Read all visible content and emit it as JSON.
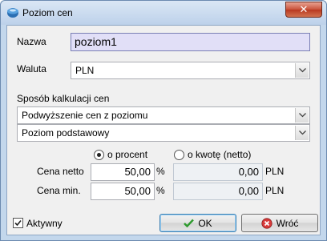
{
  "window": {
    "title": "Poziom cen",
    "close_glyph": "✕"
  },
  "form": {
    "nazwa_label": "Nazwa",
    "nazwa_value": "poziom1",
    "waluta_label": "Waluta",
    "waluta_value": "PLN",
    "sposob_label": "Sposób kalkulacji cen",
    "sposob_value": "Podwyższenie cen z poziomu",
    "poziom_value": "Poziom podstawowy",
    "radio_procent_label": "o procent",
    "radio_kwote_label": "o kwotę (netto)",
    "radio_selected": "procent",
    "cena_netto_label": "Cena netto",
    "cena_netto_value": "50,00",
    "cena_netto_unit": "%",
    "cena_netto_amount": "0,00",
    "cena_netto_currency": "PLN",
    "cena_min_label": "Cena min.",
    "cena_min_value": "50,00",
    "cena_min_unit": "%",
    "cena_min_amount": "0,00",
    "cena_min_currency": "PLN",
    "aktywny_label": "Aktywny",
    "aktywny_checked": true
  },
  "buttons": {
    "ok_label": "OK",
    "wroc_label": "Wróć"
  },
  "icons": {
    "app": "app-icon",
    "ok": "checkmark-icon",
    "wroc": "cancel-icon",
    "dropdown": "chevron-down-icon"
  }
}
